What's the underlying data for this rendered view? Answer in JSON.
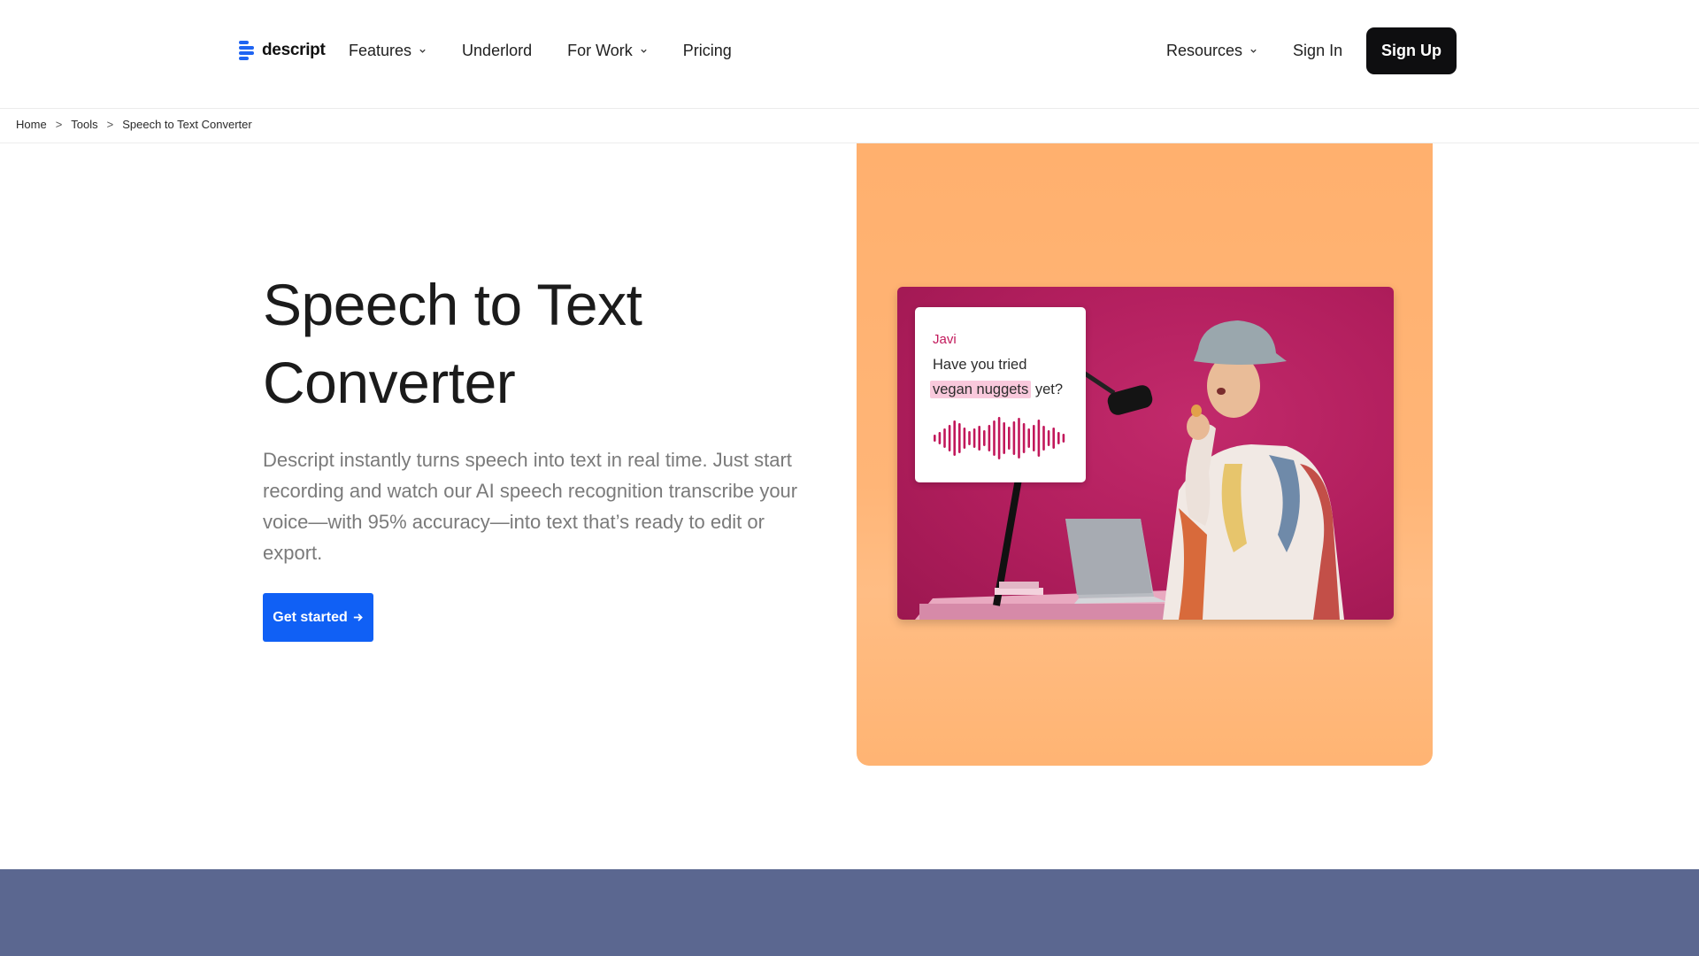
{
  "brand": {
    "name": "descript",
    "accent": "#1f64f2"
  },
  "nav": {
    "left": [
      {
        "label": "Features",
        "dropdown": true
      },
      {
        "label": "Underlord",
        "dropdown": false
      },
      {
        "label": "For Work",
        "dropdown": true
      },
      {
        "label": "Pricing",
        "dropdown": false
      }
    ],
    "resources": "Resources",
    "sign_in": "Sign In",
    "sign_up": "Sign Up"
  },
  "breadcrumb": {
    "items": [
      "Home",
      "Tools",
      "Speech to Text Converter"
    ],
    "separator": ">"
  },
  "hero": {
    "title_line1": "Speech to Text",
    "title_line2": "Converter",
    "description": "Descript instantly turns speech into text in real time. Just start recording and watch our AI speech recognition transcribe your voice—with 95% accuracy—into text that’s ready to edit or export.",
    "cta_label": "Get started",
    "cta_icon": "arrow-right-icon",
    "cta_color": "#1060f5"
  },
  "illustration": {
    "panel_color": "#ffb06e",
    "photo_bg": "#b11e5d",
    "caption": {
      "speaker": "Javi",
      "line1": "Have you tried",
      "highlight": "vegan nuggets",
      "after_highlight": " yet?",
      "waveform_color": "#c2185b"
    }
  },
  "footer_band_color": "#5b6790"
}
